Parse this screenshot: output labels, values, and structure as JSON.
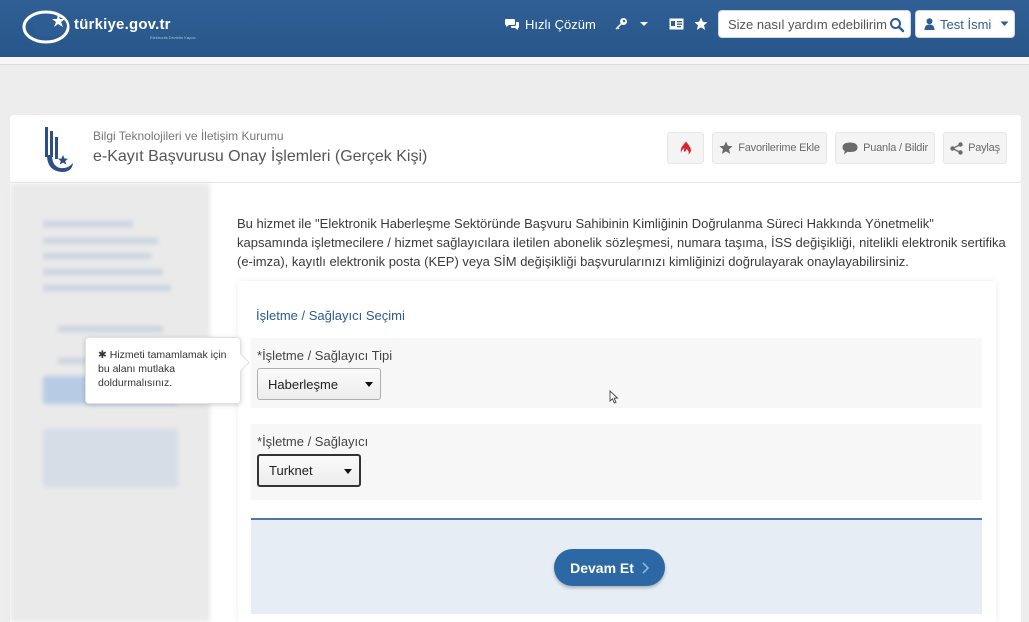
{
  "navbar": {
    "logo_text": "türkiye.gov.tr",
    "logo_subtext": "Elektronik Devletin Kapısı",
    "quick_solution": "Hızlı Çözüm",
    "search_placeholder": "Size nasıl yardım edebilirim?",
    "user_name": "Test İsmi",
    "colors": {
      "bar": "#2d5d92",
      "accent": "#2b68a4"
    }
  },
  "service": {
    "institution": "Bilgi Teknolojileri ve İletişim Kurumu",
    "title": "e-Kayıt Başvurusu Onay İşlemleri (Gerçek Kişi)",
    "actions": {
      "favorites": "Favorilerime Ekle",
      "rate": "Puanla / Bildir",
      "share": "Paylaş"
    }
  },
  "intro": "Bu hizmet ile \"Elektronik Haberleşme Sektöründe Başvuru Sahibinin Kimliğinin Doğrulanma Süreci Hakkında Yönetmelik\" kapsamında işletmecilere / hizmet sağlayıcılara iletilen abonelik sözleşmesi, numara taşıma, İSS değişikliği, nitelikli elektronik sertifika (e-imza), kayıtlı elektronik posta (KEP) veya SİM değişikliği başvurularınızı kimliğinizi doğrulayarak onaylayabilirsiniz.",
  "form": {
    "section_title": "İşletme / Sağlayıcı Seçimi",
    "required_mark": "*",
    "type_label": "İşletme / Sağlayıcı Tipi",
    "type_value": "Haberleşme",
    "provider_label": "İşletme / Sağlayıcı",
    "provider_value": "Turknet",
    "continue_label": "Devam Et"
  },
  "tooltip": {
    "bullet": "✱",
    "text": "Hizmeti tamamlamak için bu alanı mutlaka doldurmalısınız."
  }
}
